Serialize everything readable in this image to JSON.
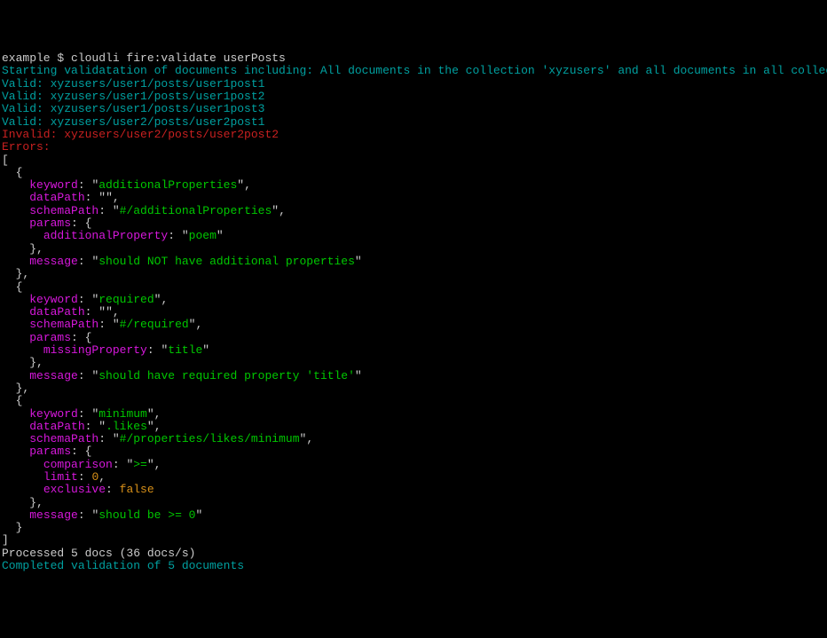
{
  "prompt": {
    "prefix": "example $ ",
    "command": "cloudli fire:validate userPosts"
  },
  "start_msg": "Starting validatation of documents including: All documents in the collection 'xyzusers' and all documents in all collections under the collection (recursive). Only documents with collection id 'posts'.",
  "valid_lines": [
    {
      "label": "Valid: ",
      "path": "xyzusers/user1/posts/user1post1"
    },
    {
      "label": "Valid: ",
      "path": "xyzusers/user1/posts/user1post2"
    },
    {
      "label": "Valid: ",
      "path": "xyzusers/user1/posts/user1post3"
    },
    {
      "label": "Valid: ",
      "path": "xyzusers/user2/posts/user2post1"
    }
  ],
  "invalid_line": {
    "label": "Invalid: ",
    "path": "xyzusers/user2/posts/user2post2"
  },
  "errors_header": "Errors:",
  "brackets": {
    "open_arr": "[",
    "close_arr": "]",
    "open_obj": "{",
    "close_obj": "}"
  },
  "punctuation": {
    "colon_space": ": ",
    "comma": ",",
    "quote": "\"",
    "space1": "  ",
    "space2": "    ",
    "space3": "      "
  },
  "keys": {
    "keyword": "keyword",
    "dataPath": "dataPath",
    "schemaPath": "schemaPath",
    "params": "params",
    "additionalProperty": "additionalProperty",
    "missingProperty": "missingProperty",
    "comparison": "comparison",
    "limit": "limit",
    "exclusive": "exclusive",
    "message": "message"
  },
  "errors": [
    {
      "keyword": "additionalProperties",
      "dataPath": "",
      "schemaPath": "#/additionalProperties",
      "param_key": "additionalProperty",
      "param_val": "poem",
      "message": "should NOT have additional properties"
    },
    {
      "keyword": "required",
      "dataPath": "",
      "schemaPath": "#/required",
      "param_key": "missingProperty",
      "param_val": "title",
      "message": "should have required property 'title'"
    },
    {
      "keyword": "minimum",
      "dataPath": ".likes",
      "schemaPath": "#/properties/likes/minimum",
      "comparison": ">=",
      "limit": "0",
      "exclusive": "false",
      "message": "should be >= 0"
    }
  ],
  "processed_msg": "Processed 5 docs (36 docs/s)",
  "completed_msg": "Completed validation of 5 documents"
}
